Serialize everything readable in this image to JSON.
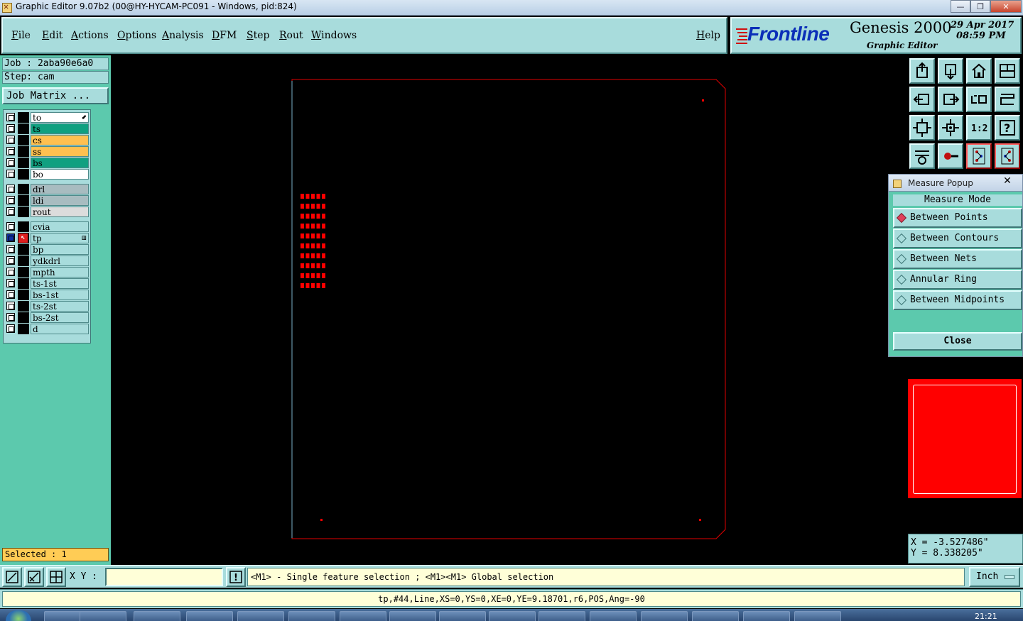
{
  "window": {
    "title": "Graphic Editor 9.07b2 (00@HY-HYCAM-PC091 - Windows, pid:824)",
    "minimize": "—",
    "maximize": "❐",
    "close": "✕"
  },
  "menu": {
    "file": "File",
    "edit": "Edit",
    "actions": "Actions",
    "options": "Options",
    "analysis": "Analysis",
    "dfm": "DFM",
    "step": "Step",
    "rout": "Rout",
    "windows": "Windows",
    "help": "Help"
  },
  "logo": {
    "brand": "Frontline",
    "product": "Genesis 2000",
    "subtitle": "Graphic Editor",
    "date": "29 Apr 2017",
    "time": "08:59 PM"
  },
  "job": {
    "job_line": "Job : 2aba90e6a0",
    "step_line": "Step: cam",
    "matrix_button": "Job Matrix ..."
  },
  "layers": [
    {
      "name": "to",
      "color": "#ffffff",
      "mark": "⬋"
    },
    {
      "name": "ts",
      "color": "#10a080"
    },
    {
      "name": "cs",
      "color": "#ffc050"
    },
    {
      "name": "ss",
      "color": "#ffc050"
    },
    {
      "name": "bs",
      "color": "#10a080"
    },
    {
      "name": "bo",
      "color": "#ffffff"
    },
    {
      "name": "drl",
      "color": "#a8bcc0"
    },
    {
      "name": "ldi",
      "color": "#a8bcc0"
    },
    {
      "name": "rout",
      "color": "#dcdcdc"
    },
    {
      "name": "cvia",
      "color": "#a8dcdc"
    },
    {
      "name": "tp",
      "color": "#a8dcdc",
      "active": true,
      "mark": "⊞"
    },
    {
      "name": "bp",
      "color": "#a8dcdc"
    },
    {
      "name": "ydkdrl",
      "color": "#a8dcdc"
    },
    {
      "name": "mpth",
      "color": "#a8dcdc"
    },
    {
      "name": "ts-1st",
      "color": "#a8dcdc"
    },
    {
      "name": "bs-1st",
      "color": "#a8dcdc"
    },
    {
      "name": "ts-2st",
      "color": "#a8dcdc"
    },
    {
      "name": "bs-2st",
      "color": "#a8dcdc"
    },
    {
      "name": "d",
      "color": "#a8dcdc"
    }
  ],
  "selected": "Selected : 1",
  "colors": {
    "panel": "#a8dcdc",
    "panel_dark": "#5cc9ad",
    "board_outline": "#e00000",
    "feature": "#ff0000"
  },
  "measure_popup": {
    "title": "Measure Popup",
    "close_x": "✕",
    "mode_title": "Measure Mode",
    "options": [
      {
        "label": "Between Points",
        "selected": true
      },
      {
        "label": "Between Contours",
        "selected": false
      },
      {
        "label": "Between Nets",
        "selected": false
      },
      {
        "label": "Annular Ring",
        "selected": false
      },
      {
        "label": "Between Midpoints",
        "selected": false
      }
    ],
    "close_label": "Close"
  },
  "coords": {
    "x": "X = -3.527486\"",
    "y": "Y = 8.338205\""
  },
  "bottom": {
    "xy_label": "X Y :",
    "xy_value": "",
    "warn": "!",
    "message": "<M1> - Single feature selection ; <M1><M1> Global selection",
    "unit": "Inch"
  },
  "status": "tp,#44,Line,XS=0,YS=0,XE=0,YE=9.18701,r6,POS,Ang=-90",
  "taskbar": {
    "clock": "21:21"
  }
}
